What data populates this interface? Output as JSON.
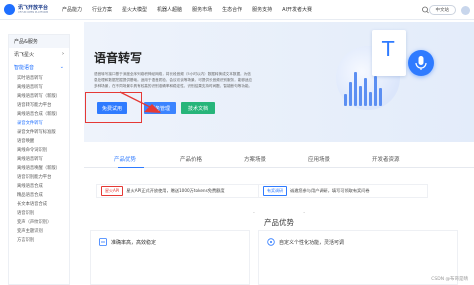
{
  "brand": {
    "name": "讯飞开放平台",
    "sub": "XFYUN OPEN PLATFORM"
  },
  "nav": {
    "items": [
      "产品能力",
      "行业方案",
      "星火大模型",
      "机器人超脑",
      "服务市场",
      "生态合作",
      "服务支持",
      "AI开发者大赛"
    ],
    "lang": "中文站"
  },
  "sidebar": {
    "head": "产品&服务",
    "groups": [
      {
        "label": "讯飞星火",
        "expanded": false
      },
      {
        "label": "智能语音",
        "expanded": true
      }
    ],
    "items": [
      "实时语音转写",
      "离线语音听写",
      "离线语音转写（新版）",
      "语音转写能力平台",
      "离线语音合成（新版）",
      "录音文件转写",
      "录音文件转写标准版",
      "语音唤醒",
      "离线命令词识别",
      "离线语音转写",
      "离线语音唤醒（新版）",
      "语音识别能力平台",
      "离线语音合成",
      "精品语音合成",
      "长文本语音合成",
      "语音识别",
      "变声（声纹识别）",
      "变声主题识别",
      "方言识别"
    ],
    "active_item": 5
  },
  "hero": {
    "title": "语音转写",
    "desc": "语音转写接口基于深度全序列卷积神经网络，将长段音频（5小时以内）数据转换成文本数据，为信息处理和数据挖掘提供基础。适用于语音质检、会议访谈等场景。可提供长音频识别服务，能够适应多种场景，在不同场景中具有较高的识别准确率和稳定性，识别结果支持时间戳、智能断句等功能。",
    "buttons": {
      "try": "免费试用",
      "manage": "服务管理",
      "docs": "技术文档"
    }
  },
  "tabs": [
    "产品优势",
    "产品价格",
    "方案场景",
    "应用场景",
    "开发者资源"
  ],
  "promo": {
    "left_badge": "星火API",
    "left_text": "星火API正式开放使用，赠送1000万tokens免费额度",
    "right_badge": "有奖调研",
    "right_text": "诚邀您参与用户调研，填写可领取有奖问卷"
  },
  "advantages": {
    "title": "产品优势",
    "items": [
      "准确率高，高效稳定",
      "自定义个性化功能，灵活可调"
    ]
  },
  "watermark": "CSDN @布哥是晴",
  "colors": {
    "accent": "#2f7bff",
    "highlight": "#e53935",
    "docs_button": "#27b57a"
  }
}
